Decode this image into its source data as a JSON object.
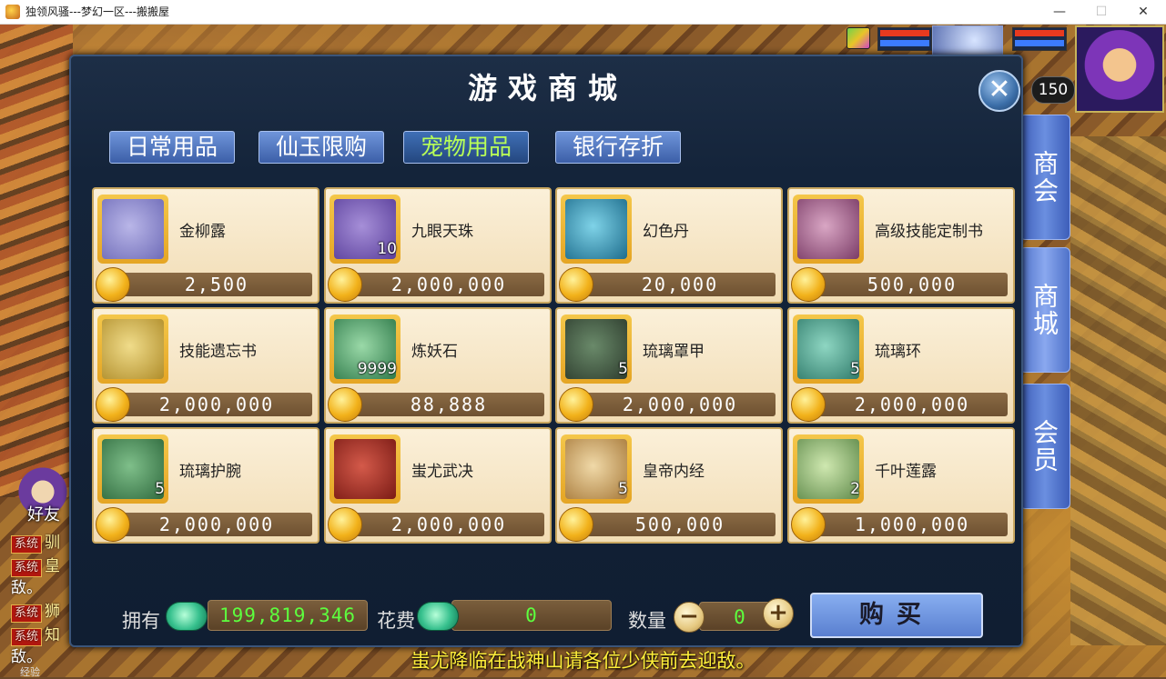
{
  "window": {
    "title": "独领风骚---梦幻一区---搬搬屋",
    "minimize": "—",
    "maximize": "☐",
    "close": "✕"
  },
  "hud": {
    "level": "150"
  },
  "chat": {
    "friend_label": "好友",
    "sys_tag": "系统",
    "lines": [
      "驯",
      "皇",
      "敌。",
      "狮",
      "知",
      "敌。"
    ],
    "exp_label": "经验"
  },
  "side_tabs": [
    "商会",
    "商城",
    "会员"
  ],
  "dialog": {
    "title": "游戏商城",
    "close_glyph": "✕",
    "tabs": [
      "日常用品",
      "仙玉限购",
      "宠物用品",
      "银行存折"
    ],
    "active_tab": 2,
    "items": [
      {
        "name": "金柳露",
        "price": "2,500",
        "qty": "",
        "icon": "herb-bottle-icon"
      },
      {
        "name": "九眼天珠",
        "price": "2,000,000",
        "qty": "10",
        "icon": "nine-eye-bead-icon"
      },
      {
        "name": "幻色丹",
        "price": "20,000",
        "qty": "",
        "icon": "pill-icon"
      },
      {
        "name": "高级技能定制书",
        "price": "500,000",
        "qty": "",
        "icon": "skill-book-icon"
      },
      {
        "name": "技能遗忘书",
        "price": "2,000,000",
        "qty": "",
        "icon": "scroll-book-icon"
      },
      {
        "name": "炼妖石",
        "price": "88,888",
        "qty": "9999",
        "icon": "crystal-icon"
      },
      {
        "name": "琉璃罩甲",
        "price": "2,000,000",
        "qty": "5",
        "icon": "armor-icon"
      },
      {
        "name": "琉璃环",
        "price": "2,000,000",
        "qty": "5",
        "icon": "ring-icon"
      },
      {
        "name": "琉璃护腕",
        "price": "2,000,000",
        "qty": "5",
        "icon": "bracer-icon"
      },
      {
        "name": "蚩尤武决",
        "price": "2,000,000",
        "qty": "",
        "icon": "red-book-icon"
      },
      {
        "name": "皇帝内经",
        "price": "500,000",
        "qty": "5",
        "icon": "classic-book-icon"
      },
      {
        "name": "千叶莲露",
        "price": "1,000,000",
        "qty": "2",
        "icon": "lotus-vase-icon"
      }
    ],
    "footer": {
      "own_label": "拥有",
      "own_value": "199,819,346",
      "cost_label": "花费",
      "cost_value": "0",
      "qty_label": "数量",
      "qty_value": "0",
      "minus": "−",
      "plus": "+",
      "buy_label": "购买"
    }
  },
  "marquee": "蚩尤降临在战神山请各位少侠前去迎敌。"
}
